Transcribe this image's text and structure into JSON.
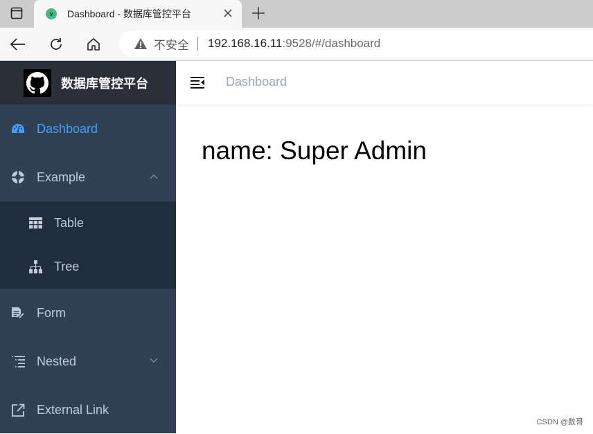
{
  "browser": {
    "tab_title": "Dashboard - 数据库管控平台",
    "favicon_letter": "v",
    "insecure_label": "不安全",
    "url_host": "192.168.16.11",
    "url_path": ":9528/#/dashboard"
  },
  "app": {
    "logo_title": "数据库管控平台",
    "breadcrumb": "Dashboard",
    "content_text": "name: Super Admin",
    "watermark": "CSDN @数哥",
    "accent_color": "#409eff",
    "sidebar_bg": "#304156",
    "submenu_bg": "#1f2d3d"
  },
  "sidebar": {
    "items": [
      {
        "label": "Dashboard",
        "icon": "dashboard-icon",
        "active": true
      },
      {
        "label": "Example",
        "icon": "example-icon",
        "expanded": true,
        "children": [
          {
            "label": "Table",
            "icon": "table-icon"
          },
          {
            "label": "Tree",
            "icon": "tree-icon"
          }
        ]
      },
      {
        "label": "Form",
        "icon": "form-icon"
      },
      {
        "label": "Nested",
        "icon": "nested-icon",
        "expanded": false
      },
      {
        "label": "External Link",
        "icon": "external-link-icon"
      }
    ]
  }
}
